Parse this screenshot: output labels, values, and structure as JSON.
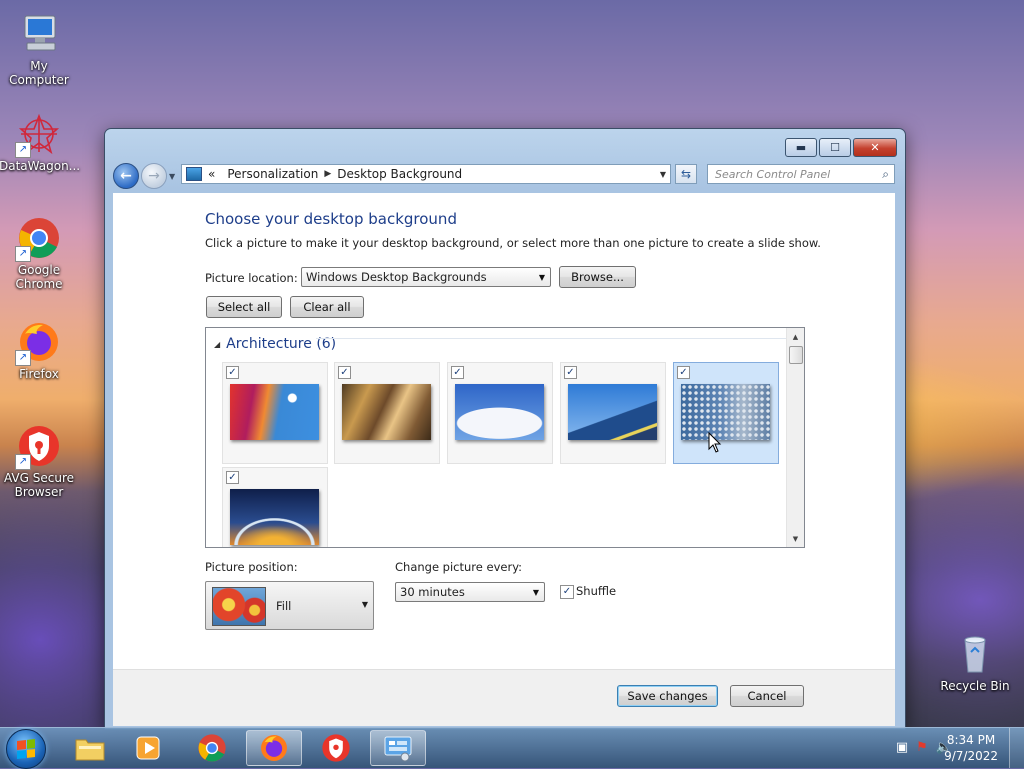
{
  "desktop": {
    "icons": [
      {
        "label": "My Computer"
      },
      {
        "label": "DataWagon..."
      },
      {
        "label": "Google Chrome"
      },
      {
        "label": "Firefox"
      },
      {
        "label": "AVG Secure Browser"
      },
      {
        "label": "Recycle Bin"
      }
    ]
  },
  "window": {
    "controls": {
      "minimize": "▬",
      "maximize": "☐",
      "close": "✕"
    },
    "nav": {
      "back": "←",
      "forward": "→",
      "breadcrumb_prefix": "«",
      "crumbs": [
        "Personalization",
        "Desktop Background"
      ],
      "search_placeholder": "Search Control Panel"
    },
    "heading": "Choose your desktop background",
    "subtext": "Click a picture to make it your desktop background, or select more than one picture to create a slide show.",
    "picture_location_label": "Picture location:",
    "picture_location_value": "Windows Desktop Backgrounds",
    "browse_label": "Browse...",
    "select_all_label": "Select all",
    "clear_all_label": "Clear all",
    "group": {
      "title": "Architecture (6)",
      "tiles": [
        {
          "checked": true,
          "selected": false
        },
        {
          "checked": true,
          "selected": false
        },
        {
          "checked": true,
          "selected": false
        },
        {
          "checked": true,
          "selected": false
        },
        {
          "checked": true,
          "selected": true
        },
        {
          "checked": true,
          "selected": false
        }
      ]
    },
    "picture_position_label": "Picture position:",
    "picture_position_value": "Fill",
    "change_every_label": "Change picture every:",
    "change_every_value": "30 minutes",
    "shuffle_label": "Shuffle",
    "shuffle_checked": true,
    "save_label": "Save changes",
    "cancel_label": "Cancel"
  },
  "taskbar": {
    "clock_time": "8:34 PM",
    "clock_date": "9/7/2022"
  }
}
